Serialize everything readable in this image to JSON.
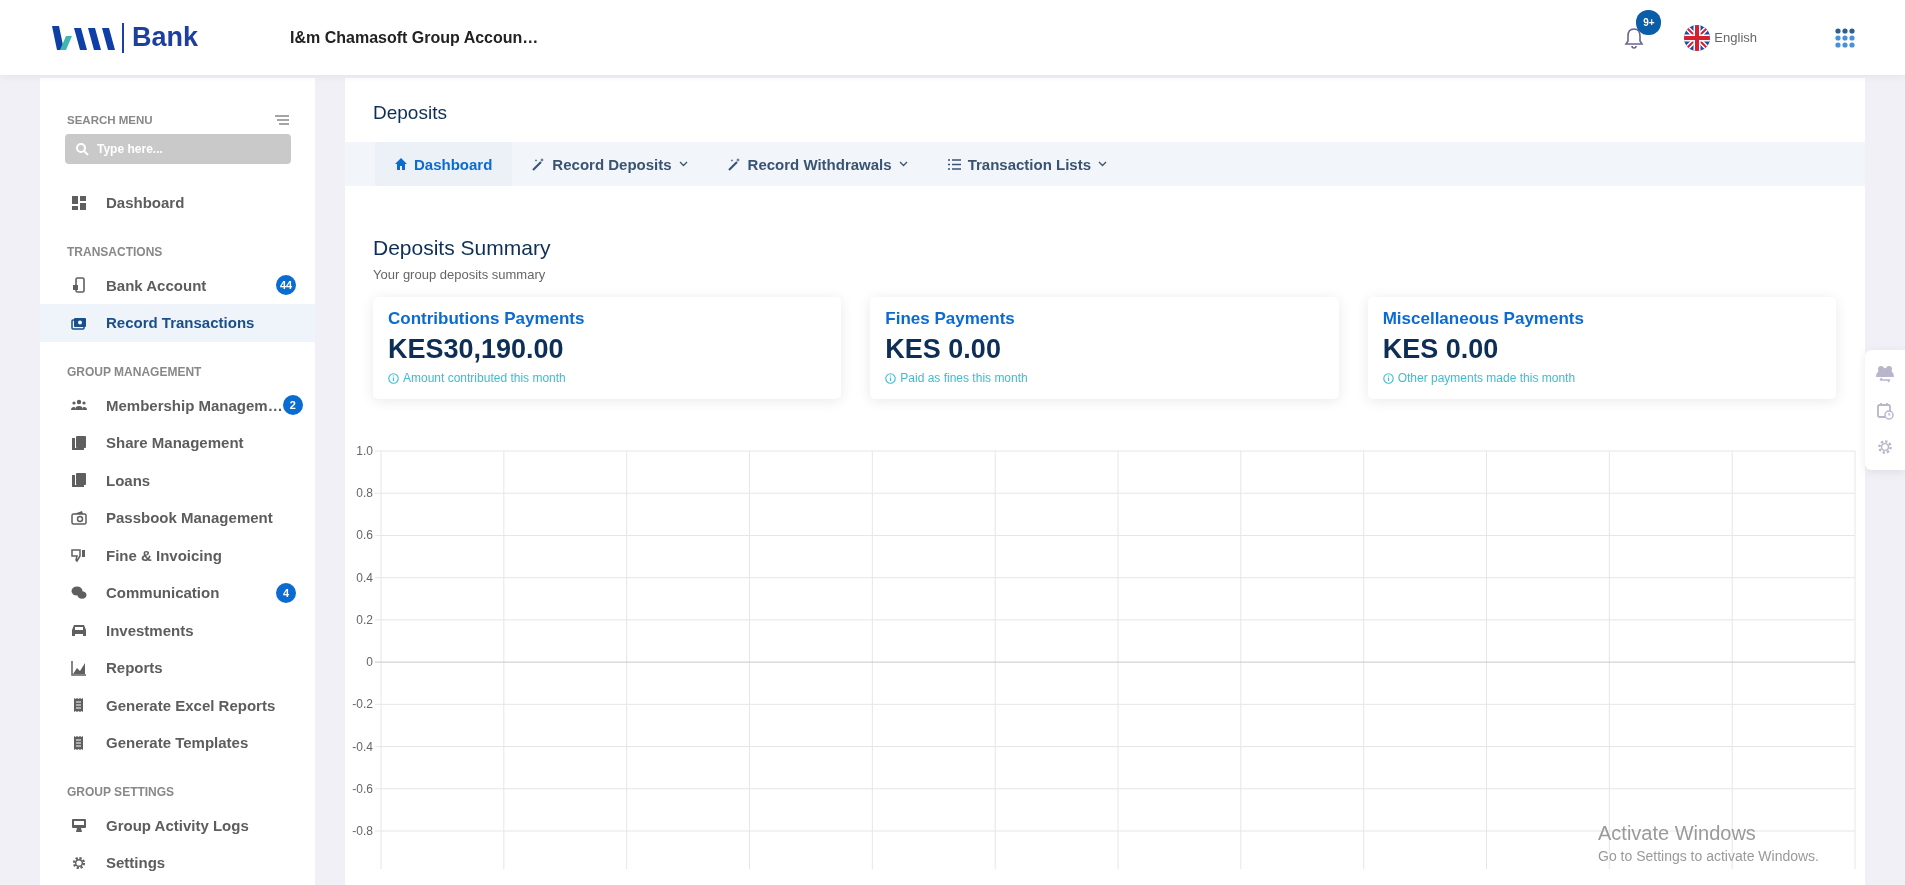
{
  "header": {
    "brand": "Bank",
    "group_name": "I&m Chamasoft Group Accoun…",
    "notifications_badge": "9+",
    "language": "English"
  },
  "sidebar": {
    "search_label": "SEARCH MENU",
    "search": {
      "placeholder": "Type here..."
    },
    "items": [
      {
        "kind": "link",
        "label": "Dashboard",
        "selected": false
      },
      {
        "kind": "heading",
        "label": "TRANSACTIONS"
      },
      {
        "kind": "link",
        "label": "Bank Account",
        "badge": "44",
        "selected": false
      },
      {
        "kind": "link",
        "label": "Record Transactions",
        "selected": true
      },
      {
        "kind": "heading",
        "label": "GROUP MANAGEMENT"
      },
      {
        "kind": "link",
        "label": "Membership Managem…",
        "badge": "2",
        "selected": false
      },
      {
        "kind": "link",
        "label": "Share Management",
        "selected": false
      },
      {
        "kind": "link",
        "label": "Loans",
        "selected": false
      },
      {
        "kind": "link",
        "label": "Passbook Management",
        "selected": false
      },
      {
        "kind": "link",
        "label": "Fine & Invoicing",
        "selected": false
      },
      {
        "kind": "link",
        "label": "Communication",
        "badge": "4",
        "selected": false
      },
      {
        "kind": "link",
        "label": "Investments",
        "selected": false
      },
      {
        "kind": "link",
        "label": "Reports",
        "selected": false
      },
      {
        "kind": "link",
        "label": "Generate Excel Reports",
        "selected": false
      },
      {
        "kind": "link",
        "label": "Generate Templates",
        "selected": false
      },
      {
        "kind": "heading",
        "label": "GROUP SETTINGS"
      },
      {
        "kind": "link",
        "label": "Group Activity Logs",
        "selected": false
      },
      {
        "kind": "link",
        "label": "Settings",
        "selected": false
      }
    ]
  },
  "page": {
    "title": "Deposits",
    "tabs": [
      {
        "label": "Dashboard",
        "selected": true,
        "dropdown": false
      },
      {
        "label": "Record Deposits",
        "selected": false,
        "dropdown": true
      },
      {
        "label": "Record Withdrawals",
        "selected": false,
        "dropdown": true
      },
      {
        "label": "Transaction Lists",
        "selected": false,
        "dropdown": true
      }
    ],
    "summary": {
      "title": "Deposits Summary",
      "subtitle": "Your group deposits summary",
      "cards": [
        {
          "title": "Contributions Payments",
          "amount": "KES30,190.00",
          "note": "Amount contributed this month"
        },
        {
          "title": "Fines Payments",
          "amount": "KES 0.00",
          "note": "Paid as fines this month"
        },
        {
          "title": "Miscellaneous Payments",
          "amount": "KES 0.00",
          "note": "Other payments made this month"
        }
      ]
    },
    "chart_data": {
      "type": "line",
      "categories": [
        null,
        null,
        null,
        null,
        null,
        null,
        null,
        null,
        null,
        null,
        null,
        null
      ],
      "values": [
        null,
        null,
        null,
        null,
        null,
        null,
        null,
        null,
        null,
        null,
        null,
        null
      ],
      "ylim": [
        -0.8,
        1
      ],
      "grid": true,
      "yticks": [
        {
          "value": 1,
          "label": "1.0"
        },
        {
          "value": 0.8,
          "label": "0.8"
        },
        {
          "value": 0.6,
          "label": "0.6"
        },
        {
          "value": 0.4,
          "label": "0.4"
        },
        {
          "value": 0.2,
          "label": "0.2"
        },
        {
          "value": 0,
          "label": "0"
        },
        {
          "value": -0.2,
          "label": "-0.2"
        },
        {
          "value": -0.4,
          "label": "-0.4"
        },
        {
          "value": -0.6,
          "label": "-0.6"
        },
        {
          "value": -0.8,
          "label": "-0.8"
        }
      ]
    }
  },
  "os_notice": {
    "title": "Activate Windows",
    "text": "Go to Settings to activate Windows."
  }
}
